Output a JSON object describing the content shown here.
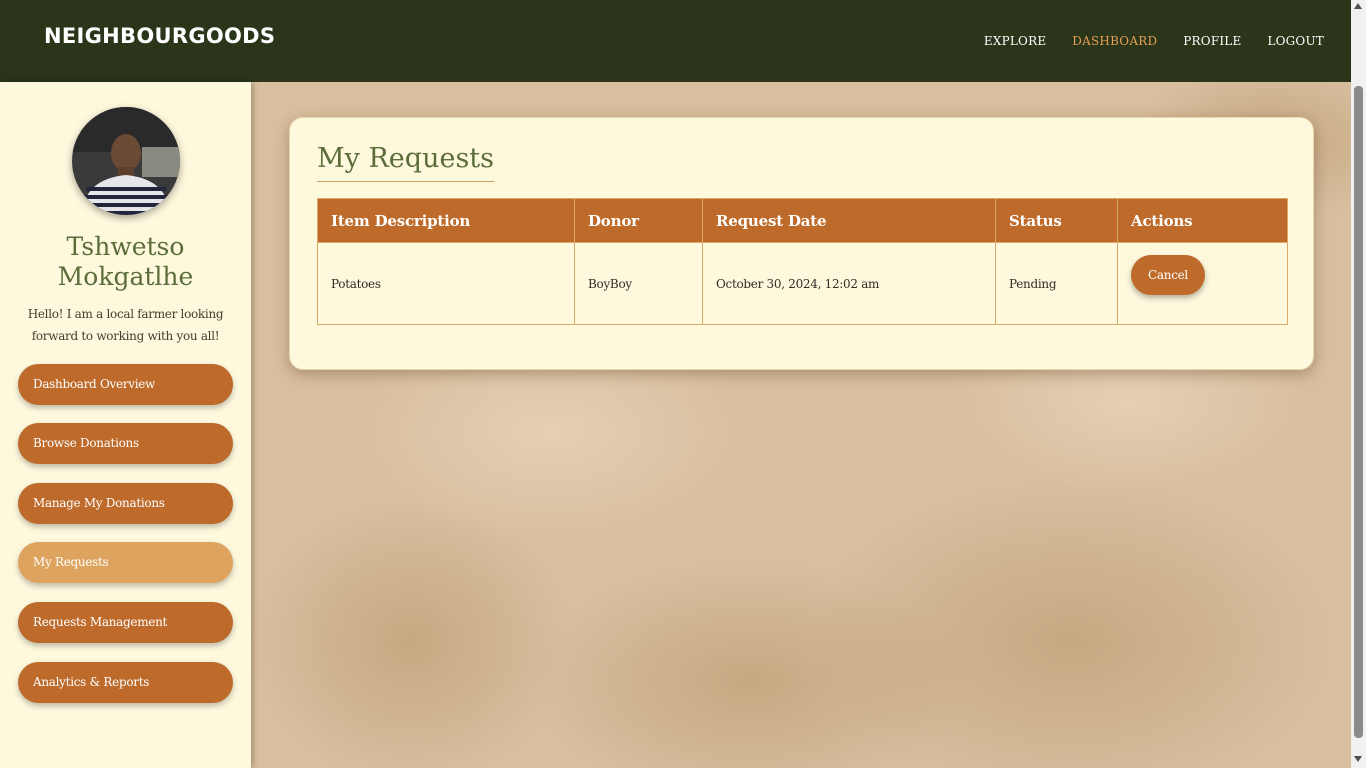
{
  "header": {
    "brand": "NEIGHBOURGOODS",
    "nav": [
      {
        "label": "EXPLORE",
        "active": false
      },
      {
        "label": "DASHBOARD",
        "active": true
      },
      {
        "label": "PROFILE",
        "active": false
      },
      {
        "label": "LOGOUT",
        "active": false
      }
    ]
  },
  "profile": {
    "name_line1": "Tshwetso",
    "name_line2": "Mokgatlhe",
    "bio_line1": "Hello! I am a local farmer looking",
    "bio_line2": "forward to working with you all!"
  },
  "sidebar": {
    "items": [
      {
        "label": "Dashboard Overview",
        "active": false
      },
      {
        "label": "Browse Donations",
        "active": false
      },
      {
        "label": "Manage My Donations",
        "active": false
      },
      {
        "label": "My Requests",
        "active": true
      },
      {
        "label": "Requests Management",
        "active": false
      },
      {
        "label": "Analytics & Reports",
        "active": false
      }
    ]
  },
  "main": {
    "title": "My Requests",
    "table": {
      "columns": [
        "Item Description",
        "Donor",
        "Request Date",
        "Status",
        "Actions"
      ],
      "rows": [
        {
          "item": "Potatoes",
          "donor": "BoyBoy",
          "date": "October 30, 2024, 12:02 am",
          "status": "Pending",
          "action_label": "Cancel"
        }
      ]
    }
  },
  "colors": {
    "navbar": "#2b3519",
    "accent": "#bd6a2a",
    "accent_active": "#dea35e",
    "active_nav": "#e3a055",
    "heading": "#5b6d3a",
    "panel": "#fef8dd"
  }
}
